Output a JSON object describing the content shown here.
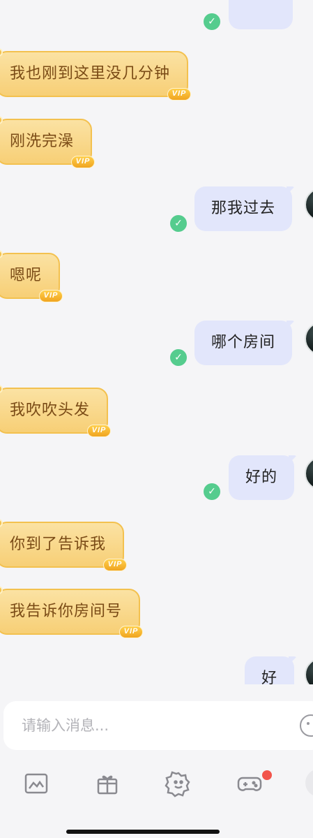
{
  "messages": [
    {
      "side": "in",
      "text": "我也刚到这里没几分钟",
      "vip": "VIP"
    },
    {
      "side": "in",
      "text": "刚洗完澡",
      "vip": "VIP"
    },
    {
      "side": "out",
      "text": "那我过去"
    },
    {
      "side": "in",
      "text": "嗯呢",
      "vip": "VIP"
    },
    {
      "side": "out",
      "text": "哪个房间"
    },
    {
      "side": "in",
      "text": "我吹吹头发",
      "vip": "VIP"
    },
    {
      "side": "out",
      "text": "好的"
    },
    {
      "side": "in",
      "text": "你到了告诉我",
      "vip": "VIP"
    },
    {
      "side": "in",
      "text": "我告诉你房间号",
      "vip": "VIP"
    },
    {
      "side": "out",
      "text": "好"
    }
  ],
  "input": {
    "placeholder": "请输入消息..."
  },
  "toolbar": {
    "icons": [
      "image-icon",
      "gift-icon",
      "sticker-icon",
      "game-icon",
      "more-icon"
    ],
    "game_has_notification": true
  },
  "colors": {
    "vip_bubble": "#f7cf76",
    "sent_bubble": "#e2e6fb",
    "check": "#55cc8e",
    "notification": "#f2544b"
  }
}
